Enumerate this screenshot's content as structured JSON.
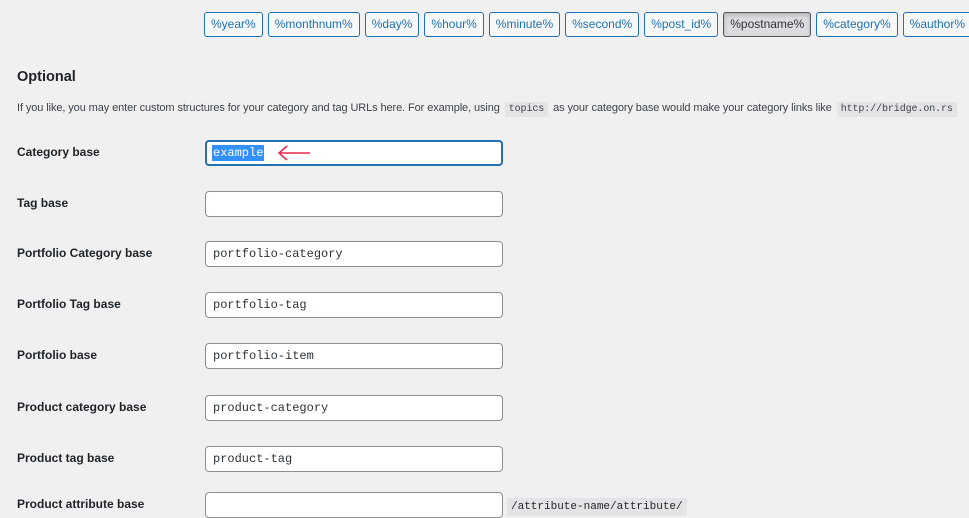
{
  "structure_tags": [
    {
      "label": "%year%",
      "active": false
    },
    {
      "label": "%monthnum%",
      "active": false
    },
    {
      "label": "%day%",
      "active": false
    },
    {
      "label": "%hour%",
      "active": false
    },
    {
      "label": "%minute%",
      "active": false
    },
    {
      "label": "%second%",
      "active": false
    },
    {
      "label": "%post_id%",
      "active": false
    },
    {
      "label": "%postname%",
      "active": true
    },
    {
      "label": "%category%",
      "active": false
    },
    {
      "label": "%author%",
      "active": false
    }
  ],
  "optional": {
    "title": "Optional",
    "desc_before": "If you like, you may enter custom structures for your category and tag URLs here. For example, using",
    "desc_code1": "topics",
    "desc_middle": "as your category base would make your category links like",
    "desc_code2": "http://bridge.on.rs"
  },
  "fields": [
    {
      "label": "Category base",
      "value": "example",
      "selected": true
    },
    {
      "label": "Tag base",
      "value": ""
    },
    {
      "label": "Portfolio Category base",
      "value": "portfolio-category"
    },
    {
      "label": "Portfolio Tag base",
      "value": "portfolio-tag"
    },
    {
      "label": "Portfolio base",
      "value": "portfolio-item"
    },
    {
      "label": "Product category base",
      "value": "product-category"
    },
    {
      "label": "Product tag base",
      "value": "product-tag"
    },
    {
      "label": "Product attribute base",
      "value": "",
      "suffix": "/attribute-name/attribute/"
    }
  ],
  "annotation_color": "#e8264f"
}
